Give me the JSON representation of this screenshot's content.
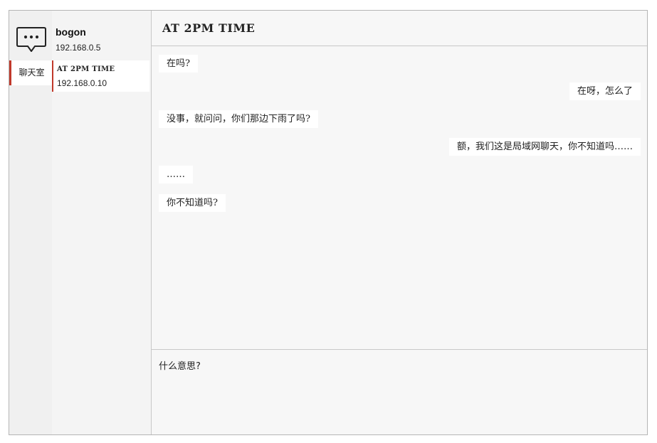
{
  "rail": {
    "app_icon": "chat-bubble-icon",
    "items": [
      {
        "label": "聊天室"
      }
    ]
  },
  "me": {
    "name": "bogon",
    "ip": "192.168.0.5"
  },
  "contacts": [
    {
      "name": "AT 2PM TIME",
      "ip": "192.168.0.10"
    }
  ],
  "chat": {
    "title": "AT 2PM TIME",
    "messages": [
      {
        "side": "left",
        "text": "在吗?"
      },
      {
        "side": "right",
        "text": "在呀，怎么了"
      },
      {
        "side": "left",
        "text": "没事，就问问，你们那边下雨了吗?"
      },
      {
        "side": "right",
        "text": "额，我们这是局域网聊天，你不知道吗……"
      },
      {
        "side": "left",
        "text": "……"
      },
      {
        "side": "left",
        "text": "你不知道吗?"
      }
    ]
  },
  "composer": {
    "value": "什么意思?"
  },
  "colors": {
    "accent": "#c0392b",
    "panel": "#f7f7f7",
    "bubble": "#ffffff"
  }
}
